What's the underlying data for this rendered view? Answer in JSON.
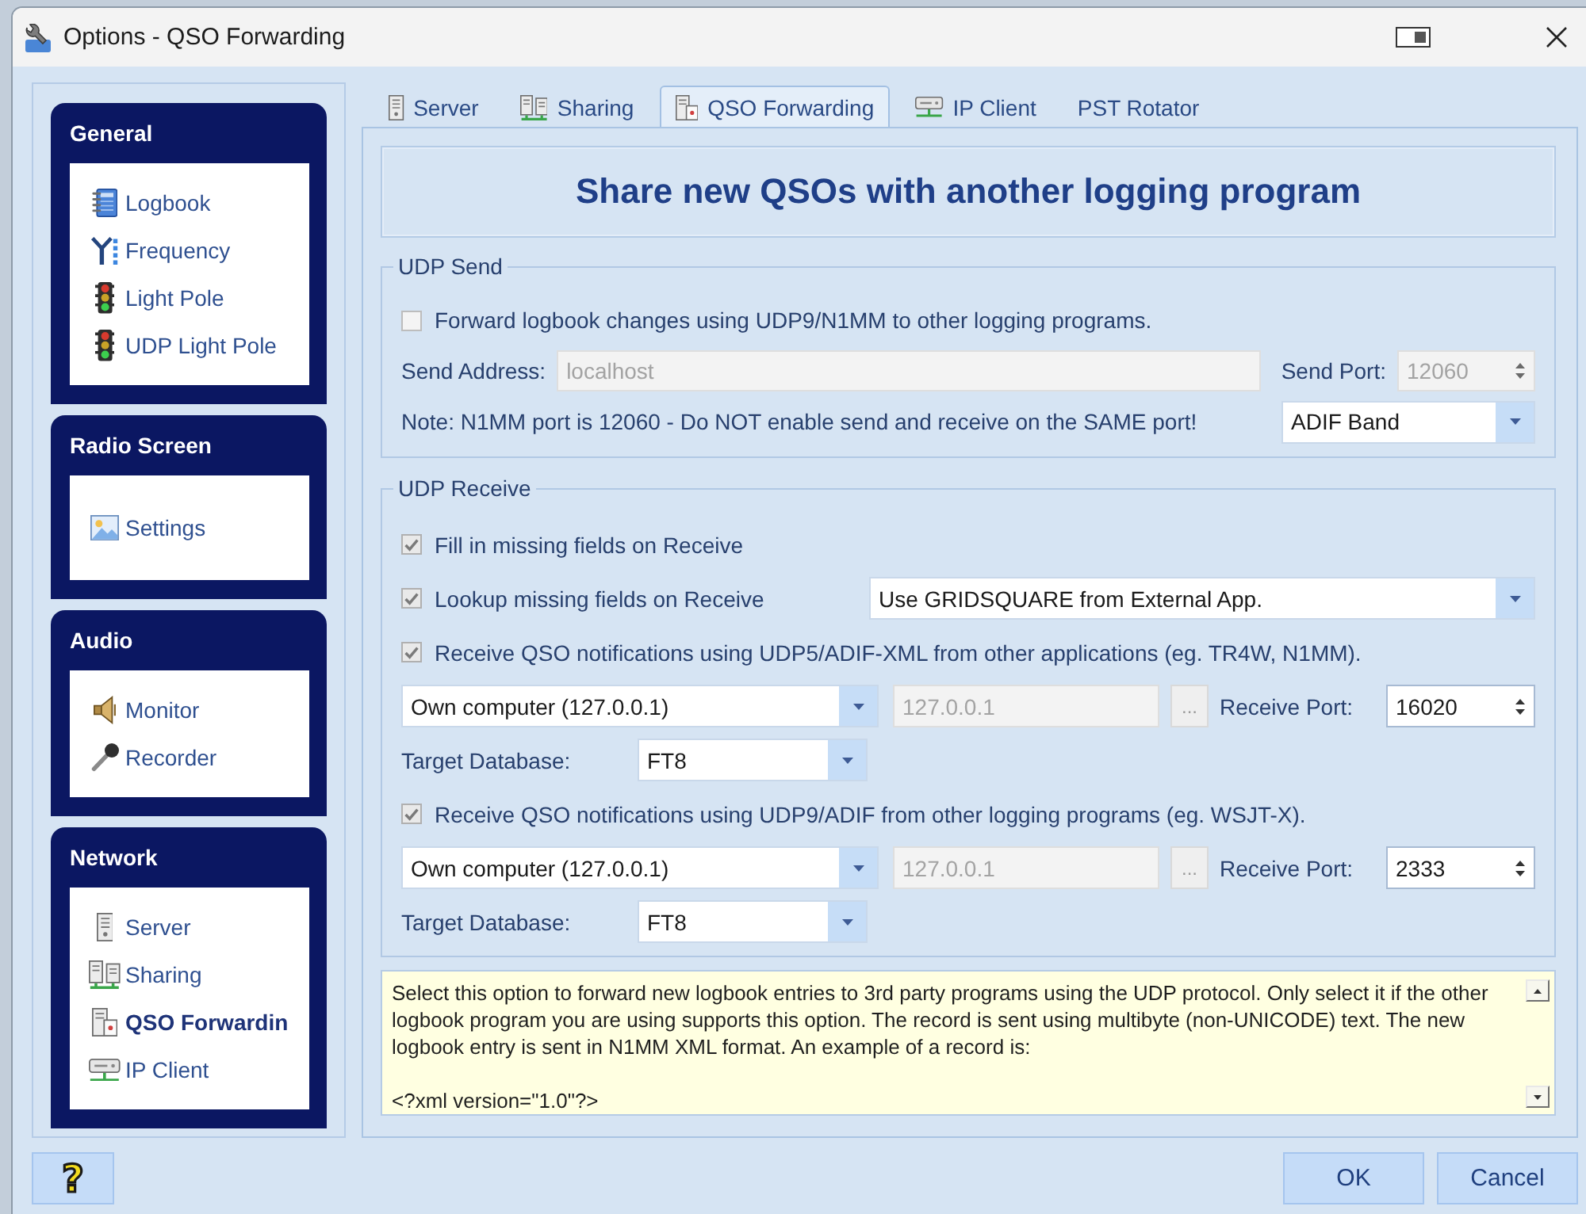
{
  "window": {
    "title": "Options - QSO Forwarding"
  },
  "sidebar": {
    "groups": [
      {
        "title": "General",
        "items": [
          {
            "label": "Logbook",
            "kind": "book",
            "selected": false
          },
          {
            "label": "Frequency",
            "kind": "antenna",
            "selected": false
          },
          {
            "label": "Light Pole",
            "kind": "lights",
            "selected": false
          },
          {
            "label": "UDP Light Pole",
            "kind": "lights",
            "selected": false
          }
        ]
      },
      {
        "title": "Radio Screen",
        "items": [
          {
            "label": "Settings",
            "kind": "picture",
            "selected": false
          }
        ]
      },
      {
        "title": "Audio",
        "items": [
          {
            "label": "Monitor",
            "kind": "speaker",
            "selected": false
          },
          {
            "label": "Recorder",
            "kind": "microphone",
            "selected": false
          }
        ]
      },
      {
        "title": "Network",
        "items": [
          {
            "label": "Server",
            "kind": "server",
            "selected": false
          },
          {
            "label": "Sharing",
            "kind": "servers",
            "selected": false
          },
          {
            "label": "QSO Forwardin",
            "kind": "forward",
            "selected": true
          },
          {
            "label": "IP Client",
            "kind": "client",
            "selected": false
          }
        ]
      }
    ]
  },
  "tabs": [
    {
      "label": "Server",
      "kind": "server",
      "selected": false
    },
    {
      "label": "Sharing",
      "kind": "servers",
      "selected": false
    },
    {
      "label": "QSO Forwarding",
      "kind": "forward",
      "selected": true
    },
    {
      "label": "IP Client",
      "kind": "client",
      "selected": false
    },
    {
      "label": "PST Rotator",
      "kind": "plain",
      "selected": false
    }
  ],
  "heading": "Share new QSOs with another logging program",
  "udp_send": {
    "legend": "UDP Send",
    "forward": {
      "label": "Forward logbook changes using UDP9/N1MM to other logging programs.",
      "checked": false
    },
    "send_address": {
      "label": "Send Address:",
      "value": "localhost",
      "disabled": true
    },
    "send_port": {
      "label": "Send Port:",
      "value": "12060",
      "disabled": true
    },
    "note": "Note: N1MM port is 12060 - Do NOT enable send and receive on the SAME port!",
    "band_dropdown": {
      "value": "ADIF Band"
    }
  },
  "udp_receive": {
    "legend": "UDP Receive",
    "fill_missing": {
      "label": "Fill in missing fields on Receive",
      "checked": true
    },
    "lookup": {
      "label": "Lookup missing fields on Receive",
      "checked": true,
      "dropdown": {
        "value": "Use GRIDSQUARE from External App."
      }
    },
    "receivers": [
      {
        "label": "Receive QSO notifications using UDP5/ADIF-XML from other applications (eg. TR4W, N1MM).",
        "checked": true,
        "source": {
          "value": "Own computer (127.0.0.1)"
        },
        "address": {
          "value": "127.0.0.1",
          "disabled": true
        },
        "browse": "...",
        "port_label": "Receive Port:",
        "port": {
          "value": "16020",
          "disabled": false
        },
        "target_label": "Target Database:",
        "target": {
          "value": "FT8"
        }
      },
      {
        "label": "Receive QSO notifications using UDP9/ADIF from other logging programs (eg. WSJT-X).",
        "checked": true,
        "source": {
          "value": "Own computer (127.0.0.1)"
        },
        "address": {
          "value": "127.0.0.1",
          "disabled": true
        },
        "browse": "...",
        "port_label": "Receive Port:",
        "port": {
          "value": "2333",
          "disabled": false
        },
        "target_label": "Target Database:",
        "target": {
          "value": "FT8"
        }
      }
    ]
  },
  "help": {
    "text": "Select this option to forward new logbook entries to 3rd party programs using the UDP protocol. Only select it if the other logbook program you are using supports this option. The record is sent using multibyte (non-UNICODE) text. The new logbook entry is sent in N1MM XML format. An example of a record is:",
    "example": "<?xml version=\"1.0\"?>"
  },
  "help_button": {
    "symbol": "?"
  },
  "buttons": [
    "OK",
    "Cancel"
  ]
}
